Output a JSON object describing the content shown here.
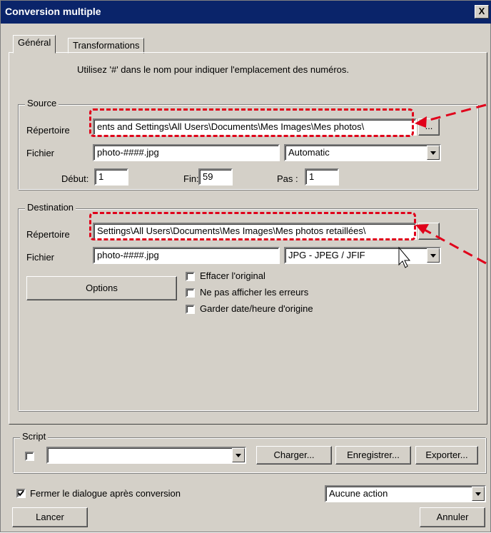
{
  "window": {
    "title": "Conversion multiple",
    "close_label": "X"
  },
  "tabs": {
    "general": "Général",
    "transformations": "Transformations"
  },
  "hint": "Utilisez '#' dans le nom pour indiquer l'emplacement des numéros.",
  "source": {
    "legend": "Source",
    "dir_label": "Répertoire",
    "dir_value": "ents and Settings\\All Users\\Documents\\Mes Images\\Mes photos\\",
    "browse_label": "...",
    "file_label": "Fichier",
    "file_value": "photo-####.jpg",
    "format_value": "Automatic",
    "start_label": "Début:",
    "start_value": "1",
    "end_label": "Fin:",
    "end_value": "59",
    "step_label": "Pas :",
    "step_value": "1"
  },
  "destination": {
    "legend": "Destination",
    "dir_label": "Répertoire",
    "dir_value": "Settings\\All Users\\Documents\\Mes Images\\Mes photos retaillées\\",
    "file_label": "Fichier",
    "file_value": "photo-####.jpg",
    "format_value": "JPG - JPEG / JFIF",
    "options_label": "Options",
    "check_delete": "Effacer l'original",
    "check_no_errors": "Ne pas afficher les erreurs",
    "check_keep_date": "Garder date/heure d'origine"
  },
  "script": {
    "legend": "Script",
    "combo_value": "",
    "load_label": "Charger...",
    "save_label": "Enregistrer...",
    "export_label": "Exporter..."
  },
  "footer": {
    "close_after_label": "Fermer le dialogue après conversion",
    "close_after_checked": true,
    "action_value": "Aucune action",
    "run_label": "Lancer",
    "cancel_label": "Annuler"
  },
  "colors": {
    "title_bar": "#0a246a",
    "dialog_bg": "#d4d0c8",
    "annotation": "#e0001a"
  }
}
